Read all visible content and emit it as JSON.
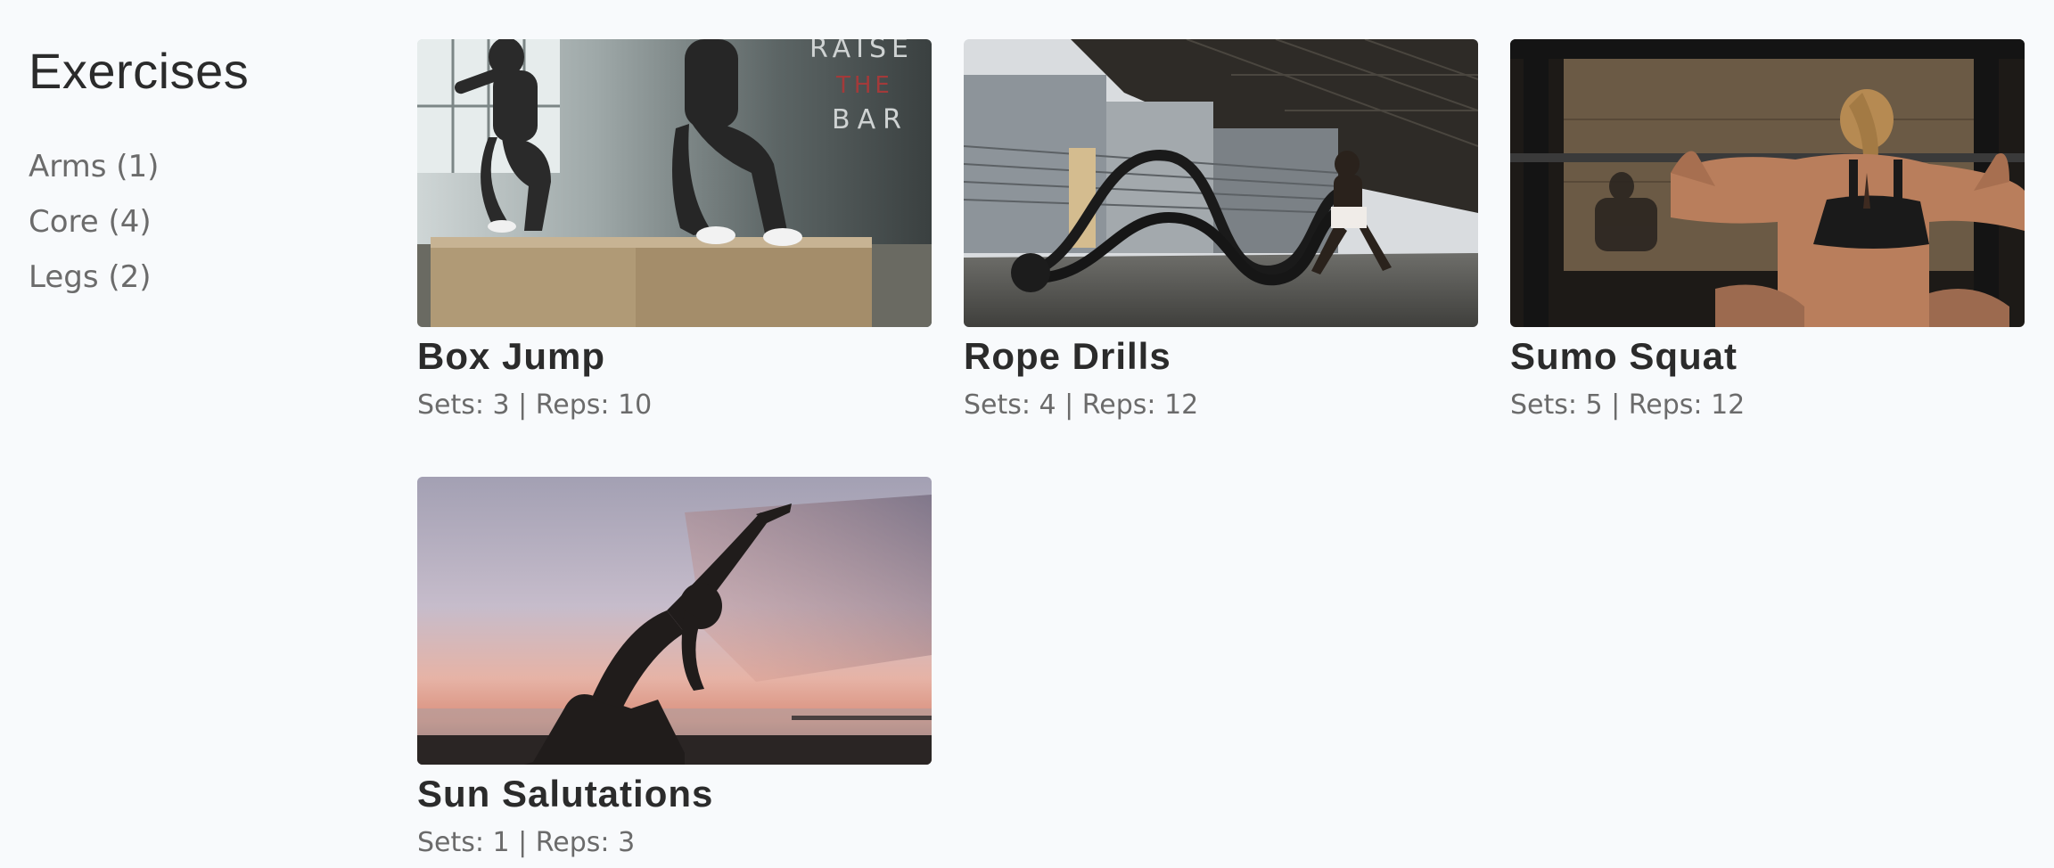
{
  "sidebar": {
    "title": "Exercises",
    "items": [
      {
        "label": "Arms (1)"
      },
      {
        "label": "Core (4)"
      },
      {
        "label": "Legs (2)"
      }
    ]
  },
  "exercises": [
    {
      "name": "Box Jump",
      "meta": "Sets: 3 | Reps: 10",
      "image": "box-jump-photo"
    },
    {
      "name": "Rope Drills",
      "meta": "Sets: 4 | Reps: 12",
      "image": "rope-drills-photo"
    },
    {
      "name": "Sumo Squat",
      "meta": "Sets: 5 | Reps: 12",
      "image": "sumo-squat-photo"
    },
    {
      "name": "Sun Salutations",
      "meta": "Sets: 1 | Reps: 3",
      "image": "sun-salutations-photo"
    }
  ],
  "photo_text": {
    "box_jump_wall": [
      "RAISE",
      "THE",
      "BAR"
    ]
  },
  "colors": {
    "background": "#f8fafc",
    "title": "#2b2b2b",
    "muted": "#6b6b6b"
  }
}
